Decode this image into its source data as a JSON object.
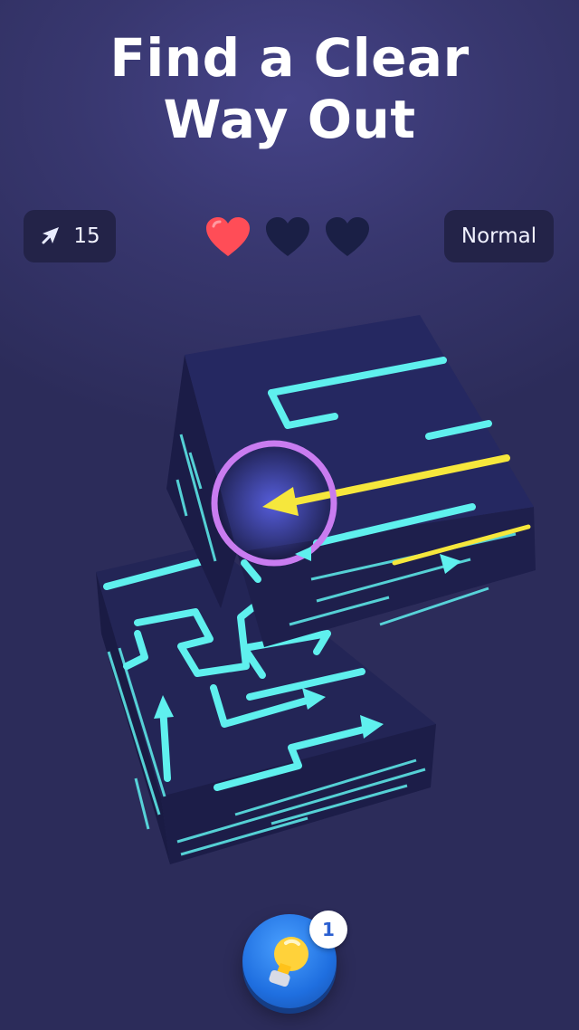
{
  "title": {
    "line1": "Find a Clear",
    "line2": "Way Out"
  },
  "stats": {
    "moves": "15",
    "moves_icon": "arrow-icon",
    "difficulty": "Normal"
  },
  "lives": {
    "total": 3,
    "remaining": 1,
    "full_color": "#ff4d57",
    "empty_color": "#1a1f45"
  },
  "hint": {
    "count": "1",
    "icon": "lightbulb-icon"
  },
  "colors": {
    "path": "#5ff0ee",
    "selected_path": "#f6e73c",
    "selector_ring": "#c97cf0",
    "cube_face": "#232556"
  }
}
